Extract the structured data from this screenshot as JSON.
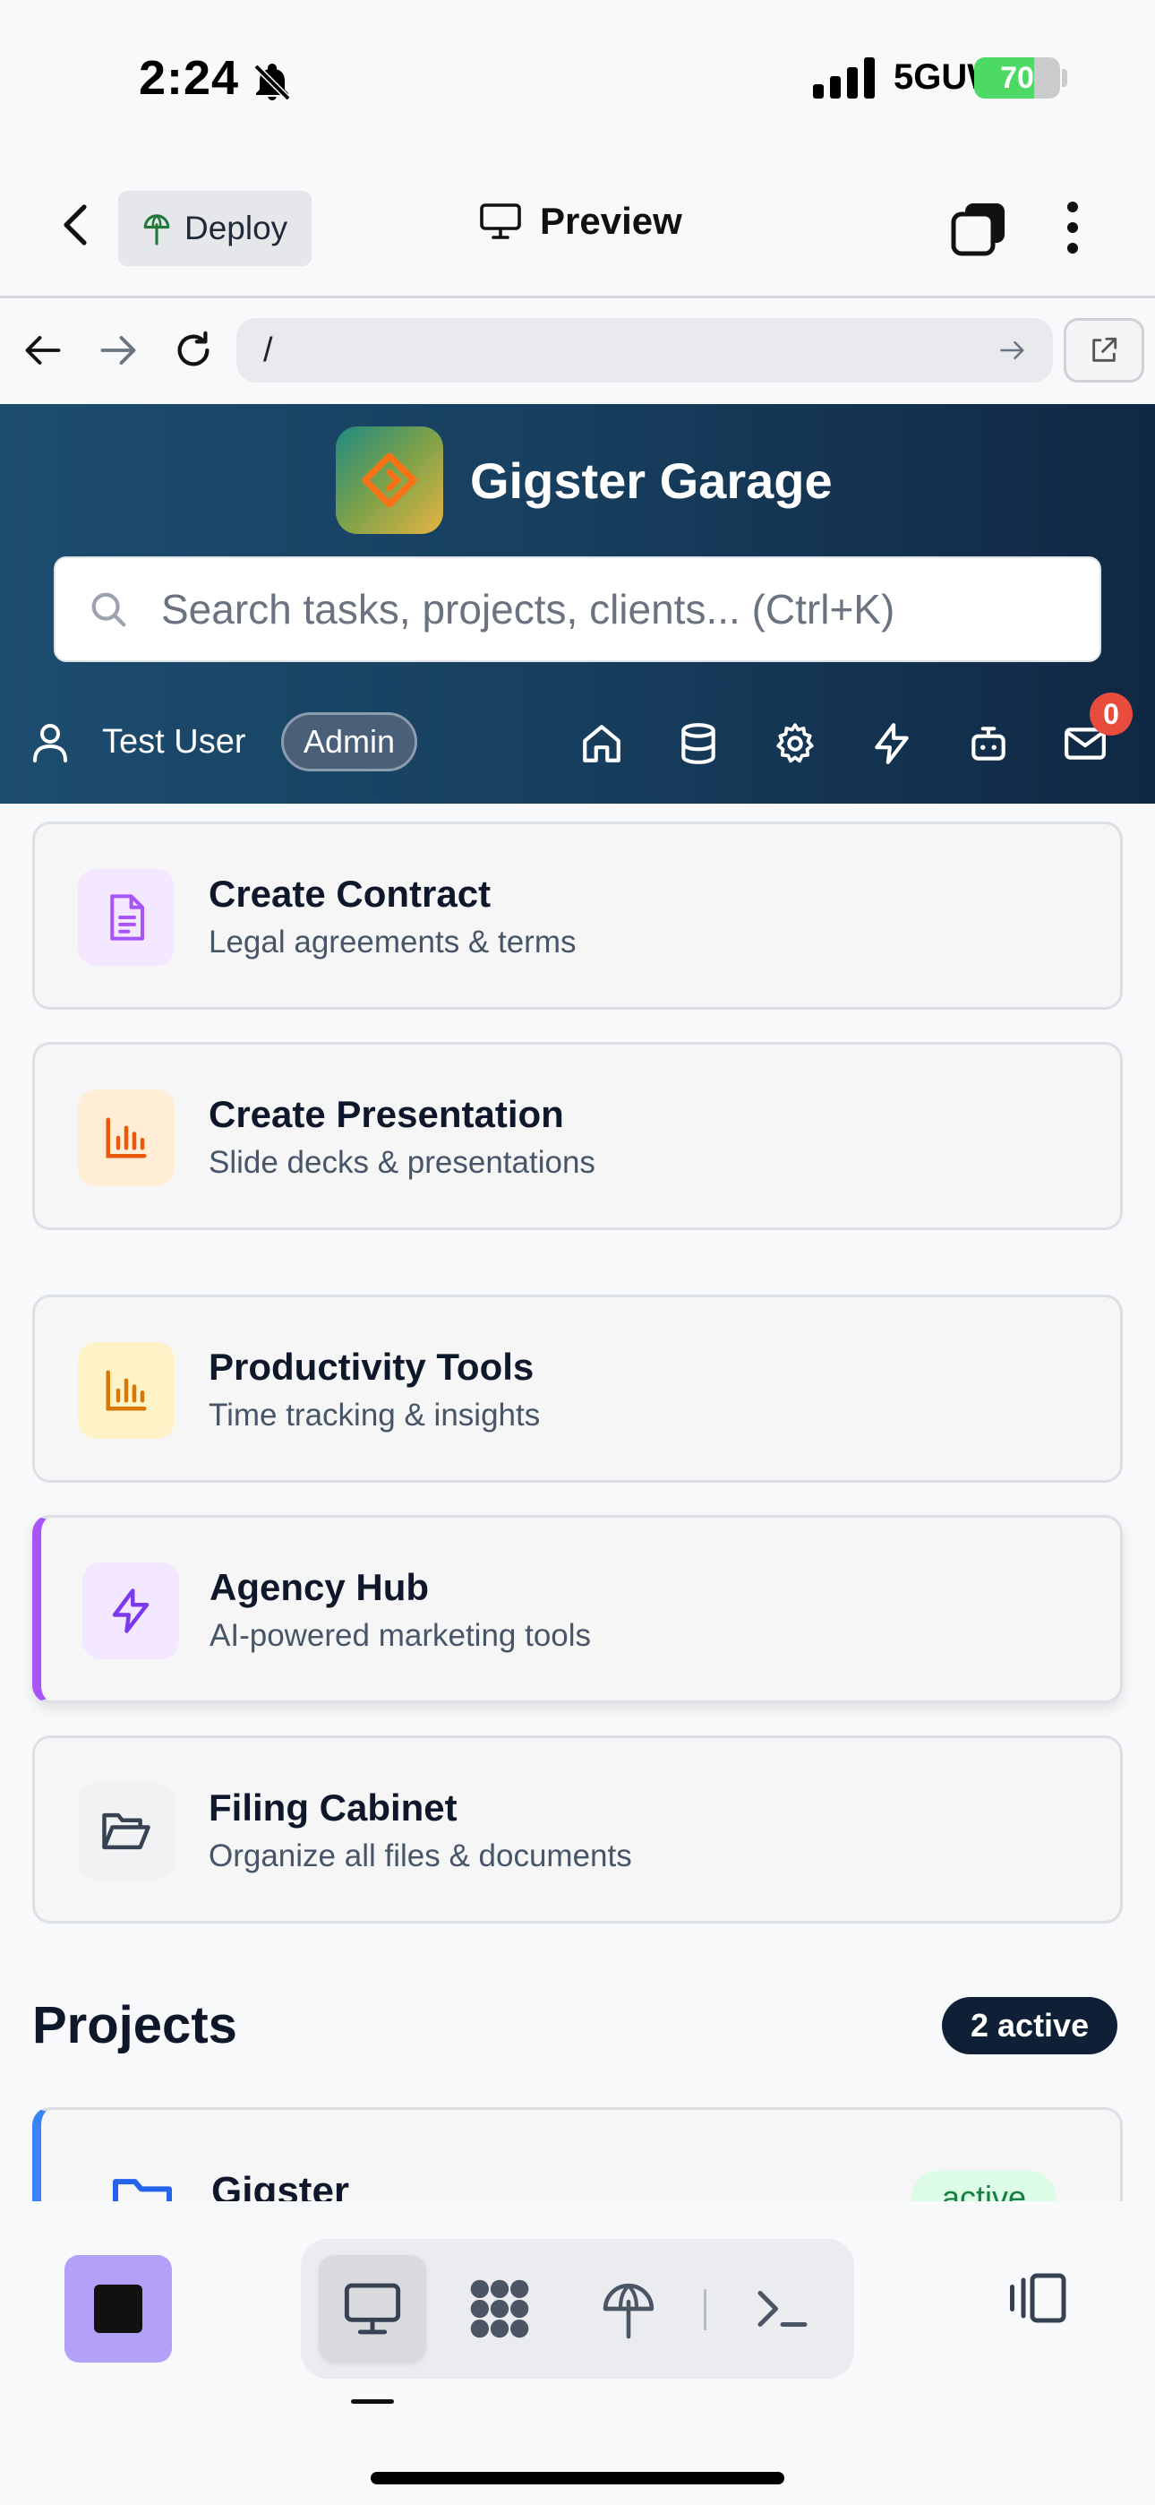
{
  "status_bar": {
    "time": "2:24",
    "network": "5GUW",
    "battery": "70",
    "battery_level": 0.7
  },
  "top_bar": {
    "deploy_label": "Deploy",
    "title": "Preview"
  },
  "browser": {
    "url": "/"
  },
  "app": {
    "name": "Gigster Garage",
    "search_placeholder": "Search tasks, projects, clients... (Ctrl+K)",
    "user_name": "Test User",
    "role": "Admin",
    "mail_count": "0"
  },
  "cards": [
    {
      "title": "Create Contract",
      "subtitle": "Legal agreements & terms",
      "icon": "document-icon",
      "icon_bg": "#f3e8ff",
      "icon_color": "#a855f7"
    },
    {
      "title": "Create Presentation",
      "subtitle": "Slide decks & presentations",
      "icon": "chart-icon",
      "icon_bg": "#ffedd5",
      "icon_color": "#ea580c"
    },
    {
      "title": "Productivity Tools",
      "subtitle": "Time tracking & insights",
      "icon": "chart-icon",
      "icon_bg": "#fef3c7",
      "icon_color": "#d97706"
    },
    {
      "title": "Agency Hub",
      "subtitle": "AI-powered marketing tools",
      "icon": "lightning-icon",
      "icon_bg": "#f3e8ff",
      "icon_color": "#7c3aed"
    },
    {
      "title": "Filing Cabinet",
      "subtitle": "Organize all files & documents",
      "icon": "folder-open-icon",
      "icon_bg": "#f1f2f4",
      "icon_color": "#374151"
    }
  ],
  "projects": {
    "title": "Projects",
    "active_count": "2 active",
    "items": [
      {
        "name": "Gigster",
        "status": "active"
      }
    ]
  },
  "colors": {
    "accent_purple": "#a855f7",
    "header_dark": "#102843",
    "project_blue": "#3b82f6",
    "stop_purple": "#b3a1f9"
  }
}
